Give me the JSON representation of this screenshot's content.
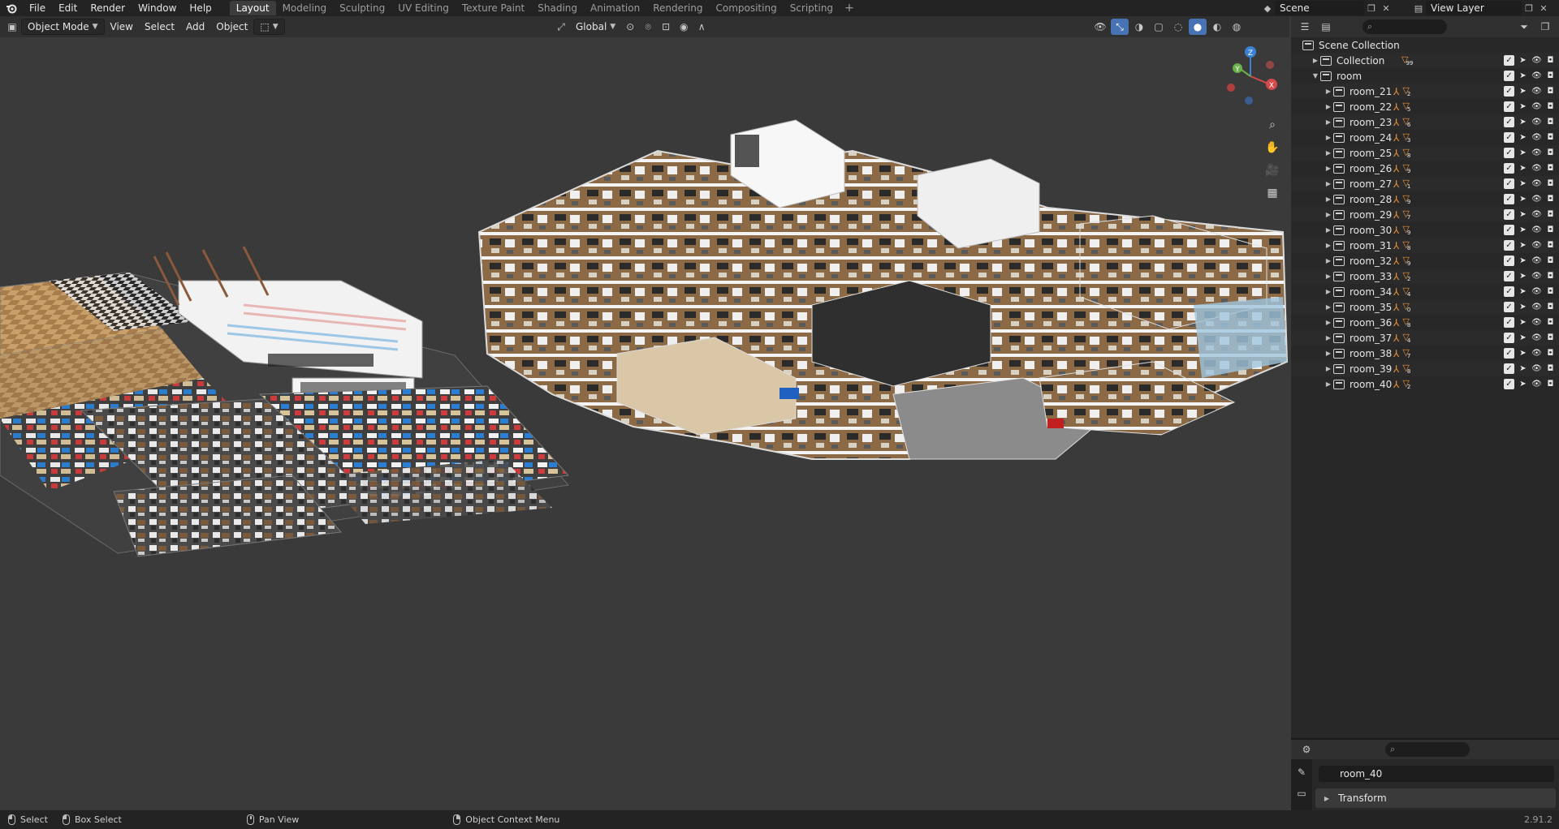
{
  "topbar": {
    "menus": [
      "File",
      "Edit",
      "Render",
      "Window",
      "Help"
    ],
    "workspaces": [
      "Layout",
      "Modeling",
      "Sculpting",
      "UV Editing",
      "Texture Paint",
      "Shading",
      "Animation",
      "Rendering",
      "Compositing",
      "Scripting"
    ],
    "active_workspace": "Layout",
    "add_tab": "+",
    "scene_name": "Scene",
    "view_layer_name": "View Layer"
  },
  "viewport_header": {
    "mode": "Object Mode",
    "menus": [
      "View",
      "Select",
      "Add",
      "Object"
    ],
    "transform_orientation": "Global"
  },
  "outliner": {
    "search_placeholder": "",
    "root": "Scene Collection",
    "top_collections": [
      {
        "name": "Collection",
        "count": "99",
        "expanded": false
      },
      {
        "name": "room",
        "expanded": true
      }
    ],
    "rooms": [
      {
        "name": "room_21",
        "count": "2"
      },
      {
        "name": "room_22",
        "count": "5"
      },
      {
        "name": "room_23",
        "count": "6"
      },
      {
        "name": "room_24",
        "count": "3"
      },
      {
        "name": "room_25",
        "count": "8"
      },
      {
        "name": "room_26",
        "count": "9"
      },
      {
        "name": "room_27",
        "count": "1"
      },
      {
        "name": "room_28",
        "count": "9"
      },
      {
        "name": "room_29",
        "count": "7"
      },
      {
        "name": "room_30",
        "count": "9"
      },
      {
        "name": "room_31",
        "count": "8"
      },
      {
        "name": "room_32",
        "count": "9"
      },
      {
        "name": "room_33",
        "count": "2"
      },
      {
        "name": "room_34",
        "count": "4"
      },
      {
        "name": "room_35",
        "count": "0"
      },
      {
        "name": "room_36",
        "count": "8"
      },
      {
        "name": "room_37",
        "count": "4"
      },
      {
        "name": "room_38",
        "count": "7"
      },
      {
        "name": "room_39",
        "count": "8"
      },
      {
        "name": "room_40",
        "count": "2"
      }
    ]
  },
  "properties": {
    "object_name": "room_40",
    "panel": "Transform"
  },
  "statusbar": {
    "select": "Select",
    "box_select": "Box Select",
    "pan_view": "Pan View",
    "context_menu": "Object Context Menu",
    "version": "2.91.2"
  },
  "gizmo": {
    "x": "X",
    "y": "Y",
    "z": "Z"
  },
  "colors": {
    "accent": "#4772b3",
    "orange": "#e8923a",
    "header": "#303030",
    "panel": "#282828",
    "viewport": "#3a3a3a"
  }
}
